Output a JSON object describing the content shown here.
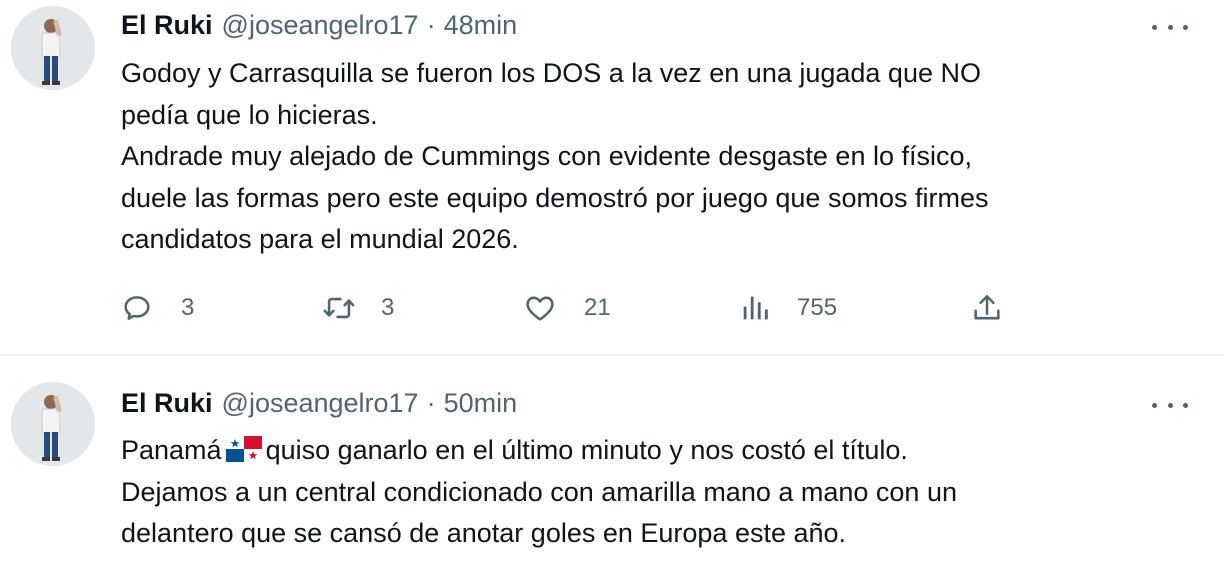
{
  "tweets": [
    {
      "author_name": "El Ruki",
      "handle": "@joseangelro17",
      "separator": "·",
      "time": "48min",
      "lines": [
        "Godoy y Carrasquilla se fueron los DOS a la vez en una jugada que NO",
        "pedía que lo hicieras.",
        "Andrade muy alejado de Cummings con evidente desgaste en lo físico,",
        "duele las formas pero este equipo demostró por juego que somos firmes",
        "candidatos para el mundial 2026."
      ],
      "replies": "3",
      "retweets": "3",
      "likes": "21",
      "views": "755"
    },
    {
      "author_name": "El Ruki",
      "handle": "@joseangelro17",
      "separator": "·",
      "time": "50min",
      "line1_before_flag": "Panamá",
      "line1_after_flag": "quiso ganarlo en el último minuto y nos costó el título.",
      "lines": [
        "Dejamos a un central condicionado con amarilla mano a mano con un",
        "delantero que se cansó de anotar goles en Europa este año."
      ]
    }
  ],
  "icons": {
    "more": "more-icon",
    "reply": "reply-icon",
    "retweet": "retweet-icon",
    "like": "heart-icon",
    "views": "views-icon",
    "share": "share-icon",
    "flag": "panama-flag-emoji"
  },
  "colors": {
    "text": "#0f1419",
    "secondary": "#536471",
    "divider": "#eff3f4"
  }
}
